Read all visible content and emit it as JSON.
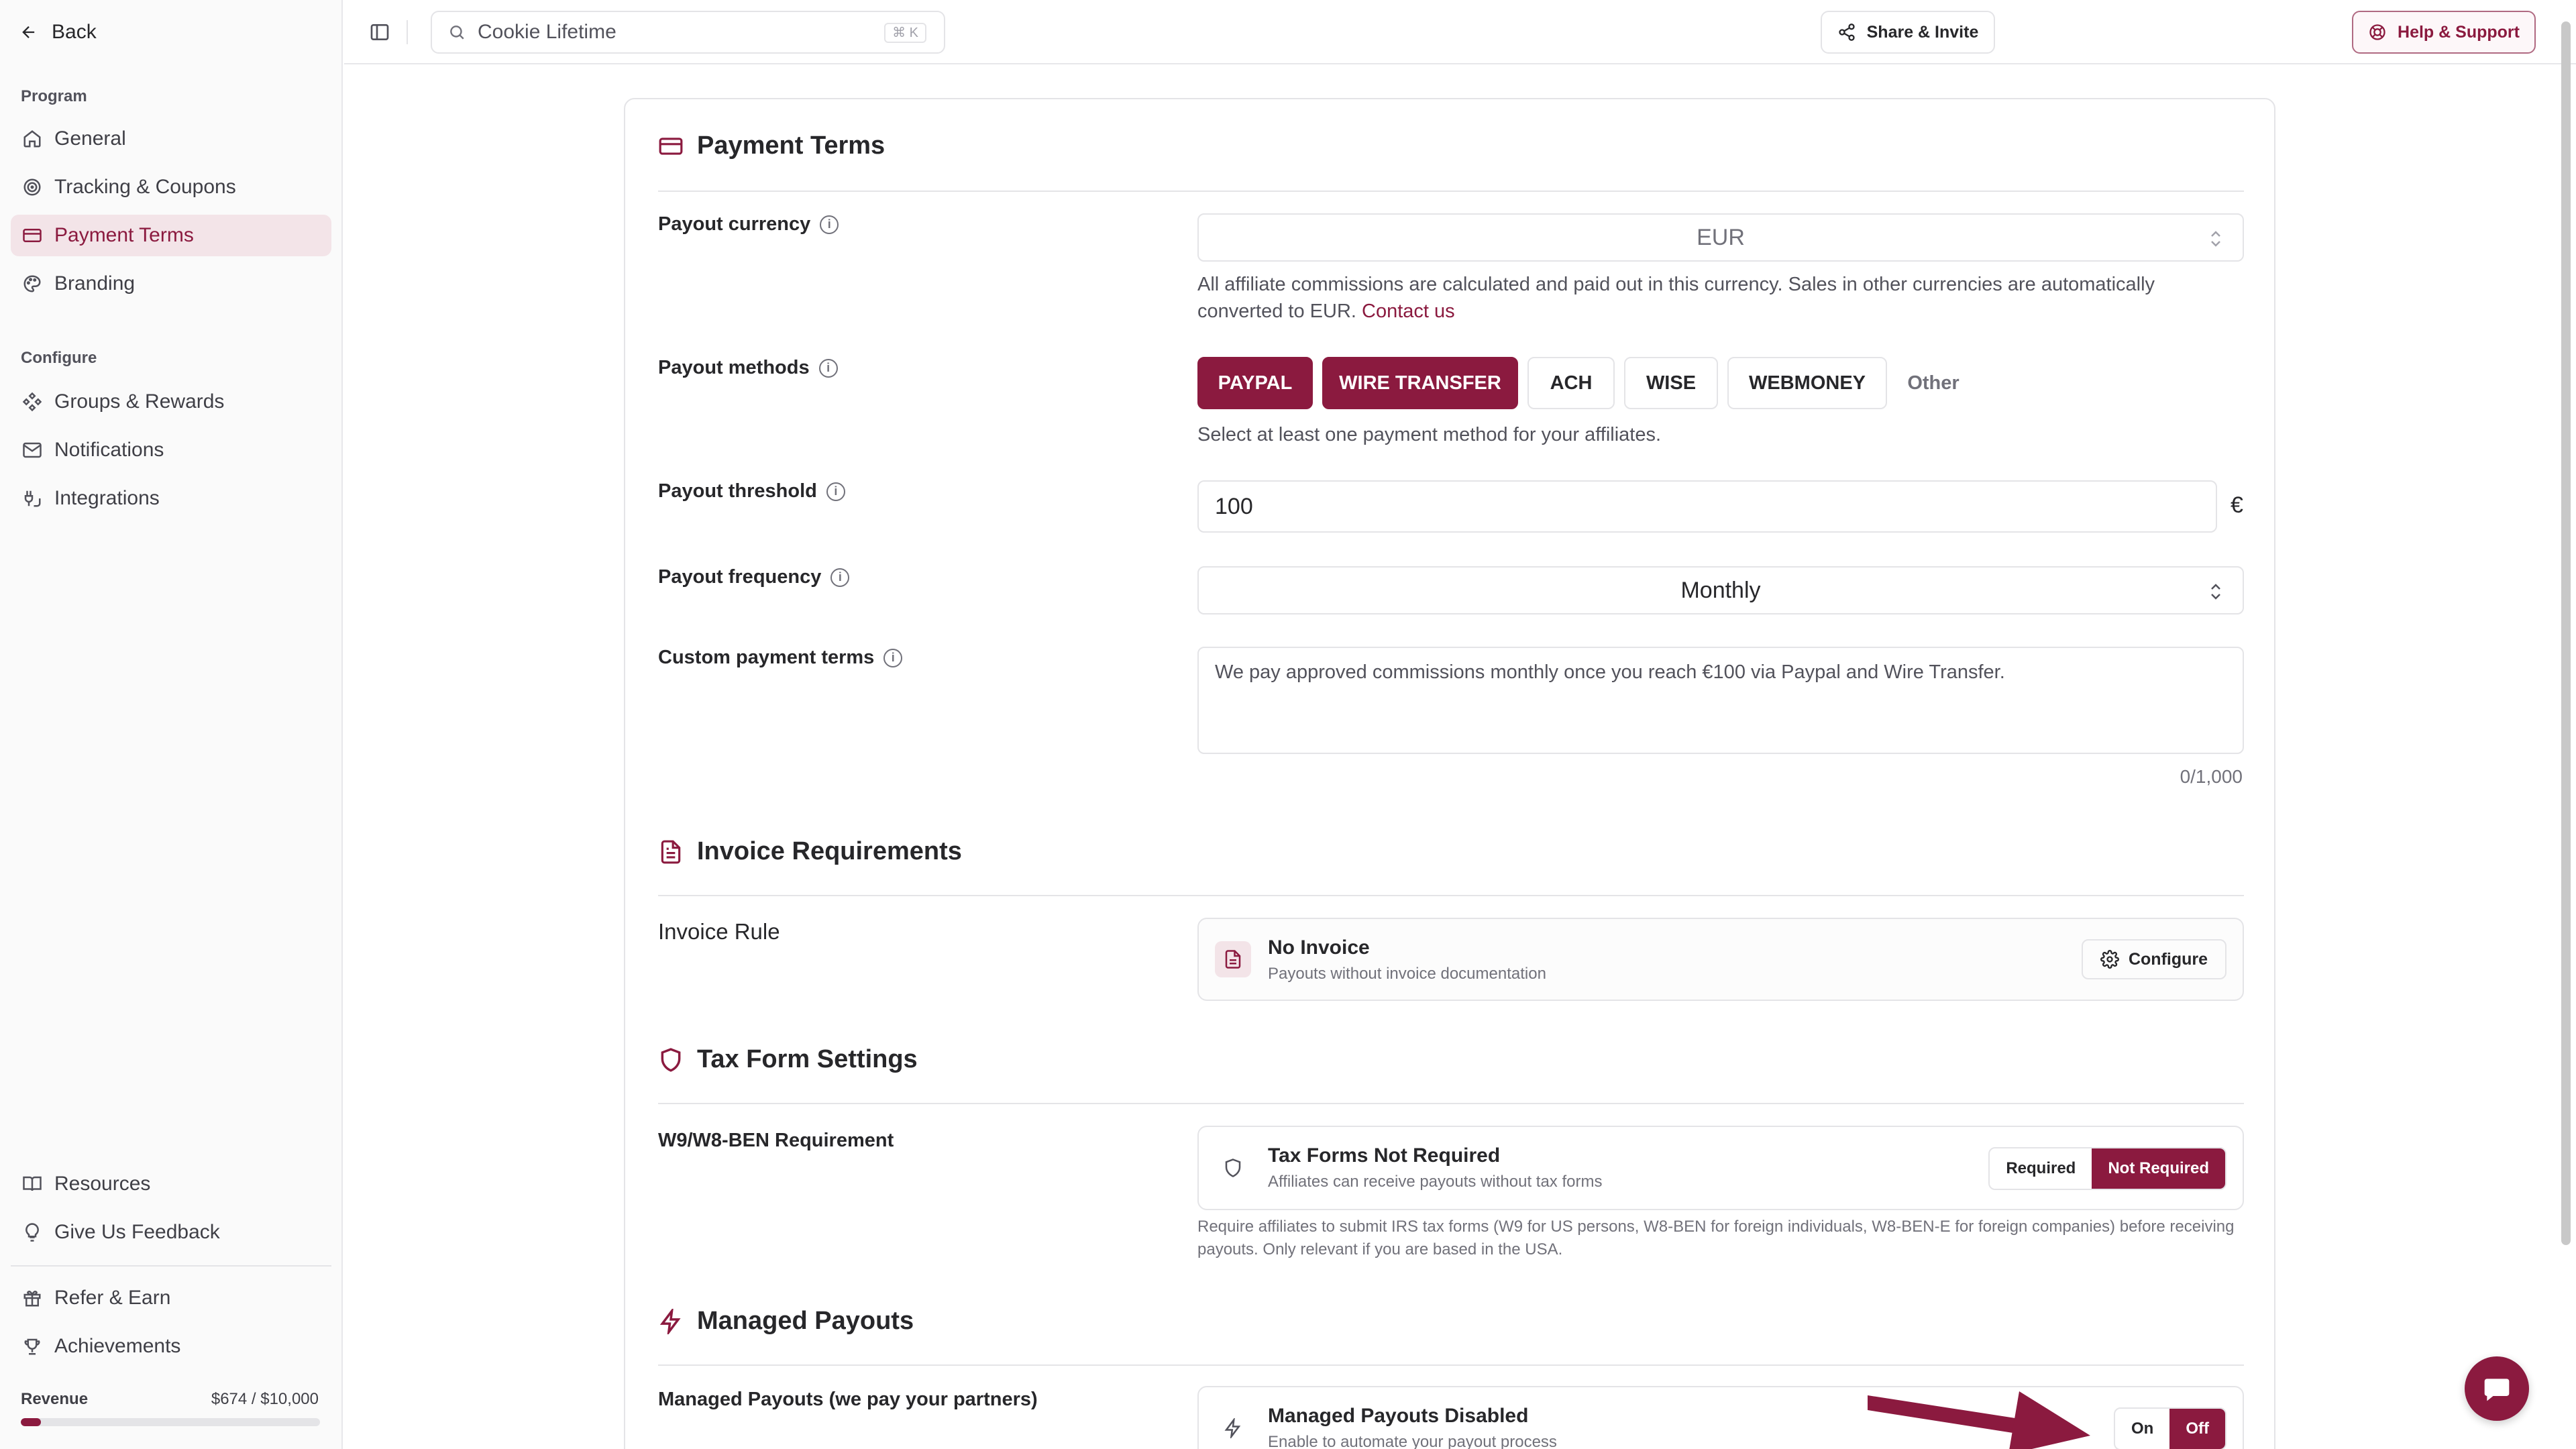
{
  "sidebar": {
    "back_label": "Back",
    "section_program": "Program",
    "section_configure": "Configure",
    "program_items": [
      {
        "label": "General",
        "icon": "home-icon"
      },
      {
        "label": "Tracking & Coupons",
        "icon": "target-icon"
      },
      {
        "label": "Payment Terms",
        "icon": "credit-card-icon",
        "active": true
      },
      {
        "label": "Branding",
        "icon": "palette-icon"
      }
    ],
    "configure_items": [
      {
        "label": "Groups & Rewards",
        "icon": "groups-icon"
      },
      {
        "label": "Notifications",
        "icon": "mail-icon"
      },
      {
        "label": "Integrations",
        "icon": "plug-icon"
      }
    ],
    "bottom_items": [
      {
        "label": "Resources",
        "icon": "book-icon"
      },
      {
        "label": "Give Us Feedback",
        "icon": "lightbulb-icon"
      },
      {
        "label": "Refer & Earn",
        "icon": "gift-icon"
      },
      {
        "label": "Achievements",
        "icon": "trophy-icon"
      }
    ],
    "revenue": {
      "label": "Revenue",
      "value": "$674 / $10,000",
      "progress": 0.0674
    }
  },
  "topbar": {
    "search_value": "Cookie Lifetime",
    "search_shortcut": "⌘ K",
    "share_label": "Share & Invite",
    "help_label": "Help & Support"
  },
  "payment_terms": {
    "title": "Payment Terms",
    "currency": {
      "label": "Payout currency",
      "value": "EUR",
      "help": "All affiliate commissions are calculated and paid out in this currency. Sales in other currencies are automatically converted to EUR.",
      "help_link": "Contact us"
    },
    "methods": {
      "label": "Payout methods",
      "options": [
        {
          "label": "PAYPAL",
          "selected": true
        },
        {
          "label": "WIRE TRANSFER",
          "selected": true
        },
        {
          "label": "ACH",
          "selected": false
        },
        {
          "label": "WISE",
          "selected": false
        },
        {
          "label": "WEBMONEY",
          "selected": false
        }
      ],
      "other_label": "Other",
      "help": "Select at least one payment method for your affiliates."
    },
    "threshold": {
      "label": "Payout threshold",
      "value": "100",
      "currency_symbol": "€"
    },
    "frequency": {
      "label": "Payout frequency",
      "value": "Monthly"
    },
    "custom_terms": {
      "label": "Custom payment terms",
      "placeholder": "We pay approved commissions monthly once you reach €100 via Paypal and Wire Transfer.",
      "counter": "0/1,000"
    }
  },
  "invoice": {
    "title": "Invoice Requirements",
    "rule_label": "Invoice Rule",
    "status_title": "No Invoice",
    "status_sub": "Payouts without invoice documentation",
    "configure_label": "Configure"
  },
  "tax": {
    "title": "Tax Form Settings",
    "label": "W9/W8-BEN Requirement",
    "status_title": "Tax Forms Not Required",
    "status_sub": "Affiliates can receive payouts without tax forms",
    "opt_required": "Required",
    "opt_not_required": "Not Required",
    "help": "Require affiliates to submit IRS tax forms (W9 for US persons, W8-BEN for foreign individuals, W8-BEN-E for foreign companies) before receiving payouts. Only relevant if you are based in the USA."
  },
  "managed": {
    "title": "Managed Payouts",
    "label": "Managed Payouts (we pay your partners)",
    "status_title": "Managed Payouts Disabled",
    "status_sub": "Enable to automate your payout process",
    "opt_on": "On",
    "opt_off": "Off"
  },
  "colors": {
    "accent": "#8b1a3f",
    "accent_light": "#f3e4e8"
  }
}
